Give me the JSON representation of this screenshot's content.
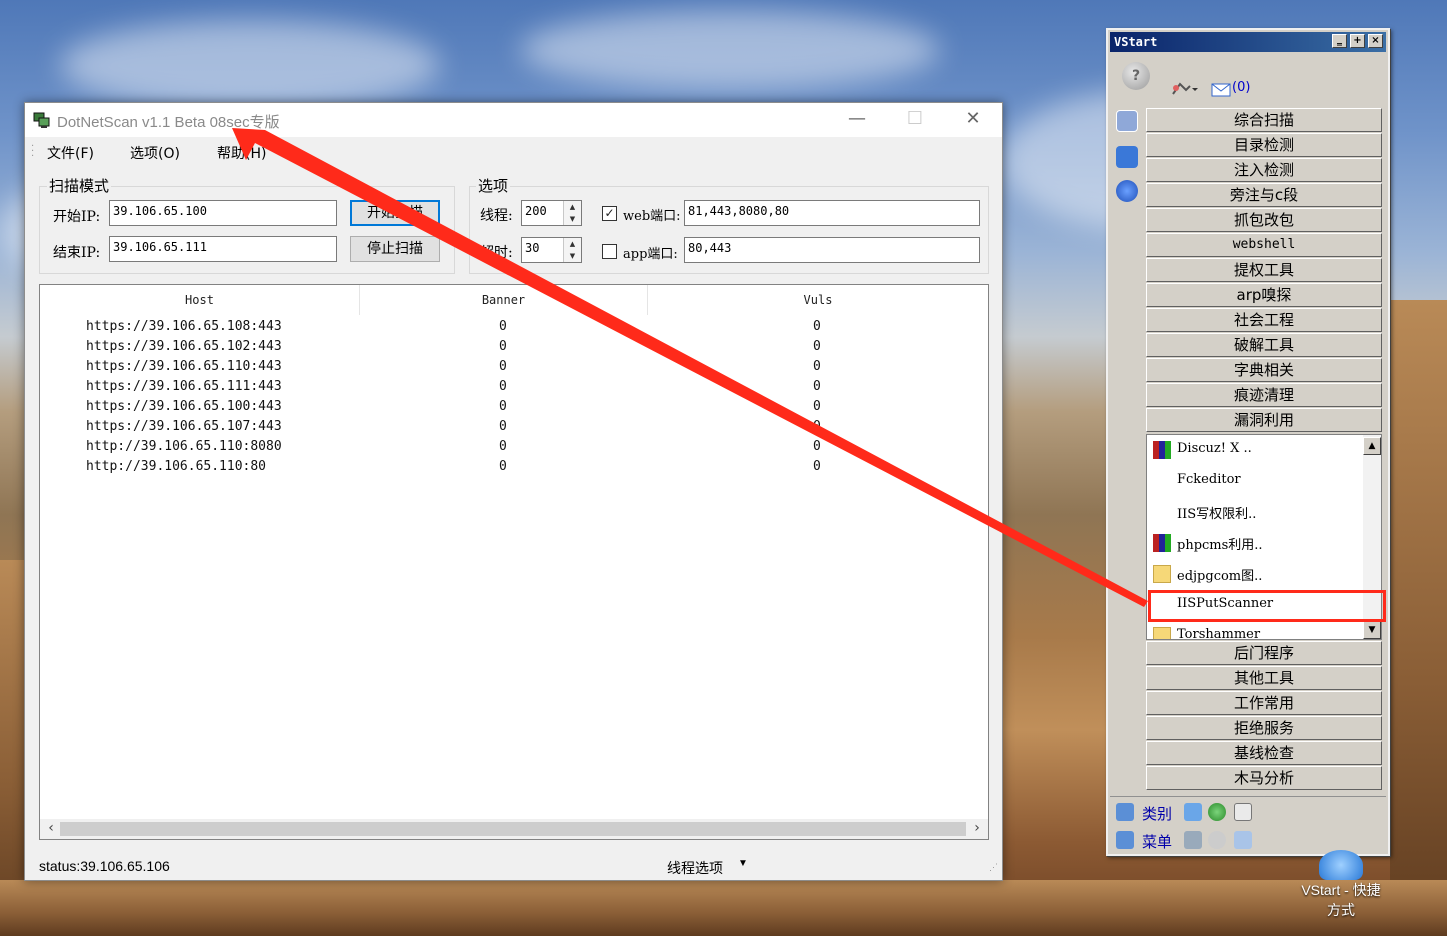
{
  "scanner": {
    "title": "DotNetScan v1.1 Beta 08sec专版",
    "controls": {
      "minimize": "—",
      "maximize": "☐",
      "close": "✕"
    },
    "menu": {
      "file": "文件(F)",
      "options": "选项(O)",
      "help": "帮助(H)"
    },
    "scan_mode": {
      "title": "扫描模式",
      "start_ip_label": "开始IP:",
      "start_ip": "39.106.65.100",
      "end_ip_label": "结束IP:",
      "end_ip": "39.106.65.111",
      "start_button": "开始扫描",
      "stop_button": "停止扫描"
    },
    "options": {
      "title": "选项",
      "threads_label": "线程:",
      "threads": "200",
      "timeout_label": "超时:",
      "timeout": "30",
      "web_port_label": "web端口:",
      "web_port_checked": true,
      "web_ports": "81,443,8080,80",
      "app_port_label": "app端口:",
      "app_port_checked": false,
      "app_ports": "80,443"
    },
    "table": {
      "headers": [
        "Host",
        "Banner",
        "Vuls"
      ],
      "rows": [
        [
          "https://39.106.65.108:443",
          "0",
          "0"
        ],
        [
          "https://39.106.65.102:443",
          "0",
          "0"
        ],
        [
          "https://39.106.65.110:443",
          "0",
          "0"
        ],
        [
          "https://39.106.65.111:443",
          "0",
          "0"
        ],
        [
          "https://39.106.65.100:443",
          "0",
          "0"
        ],
        [
          "https://39.106.65.107:443",
          "0",
          "0"
        ],
        [
          "http://39.106.65.110:8080",
          "0",
          "0"
        ],
        [
          "http://39.106.65.110:80",
          "0",
          "0"
        ]
      ]
    },
    "status": {
      "text": "status:39.106.65.106",
      "thread_options": "线程选项"
    }
  },
  "vstart": {
    "title": "VStart",
    "mail": "(0)",
    "categories_top": [
      "综合扫描",
      "目录检测",
      "注入检测",
      "旁注与c段",
      "抓包改包",
      "webshell",
      "提权工具",
      "arp嗅探",
      "社会工程",
      "破解工具",
      "字典相关",
      "痕迹清理",
      "漏洞利用"
    ],
    "tools": [
      {
        "name": "Discuz! X ..",
        "icon": "winrar-icon"
      },
      {
        "name": "Fckeditor",
        "icon": ""
      },
      {
        "name": "IIS写权限利..",
        "icon": ""
      },
      {
        "name": "phpcms利用..",
        "icon": "winrar-icon"
      },
      {
        "name": "edjpgcom图..",
        "icon": "folder-icon"
      },
      {
        "name": "IISPutScanner",
        "icon": ""
      },
      {
        "name": "Torshammer",
        "icon": "folder-icon"
      }
    ],
    "categories_bottom": [
      "后门程序",
      "其他工具",
      "工作常用",
      "拒绝服务",
      "基线检查",
      "木马分析"
    ],
    "bottom": {
      "category": "类别",
      "menu": "菜单"
    }
  },
  "desktop": {
    "shortcut_label": "VStart - 快捷方式"
  },
  "colors": {
    "annotation": "#ff2a1a",
    "vstart_title": "#0a246a",
    "focus": "#0078d7"
  }
}
